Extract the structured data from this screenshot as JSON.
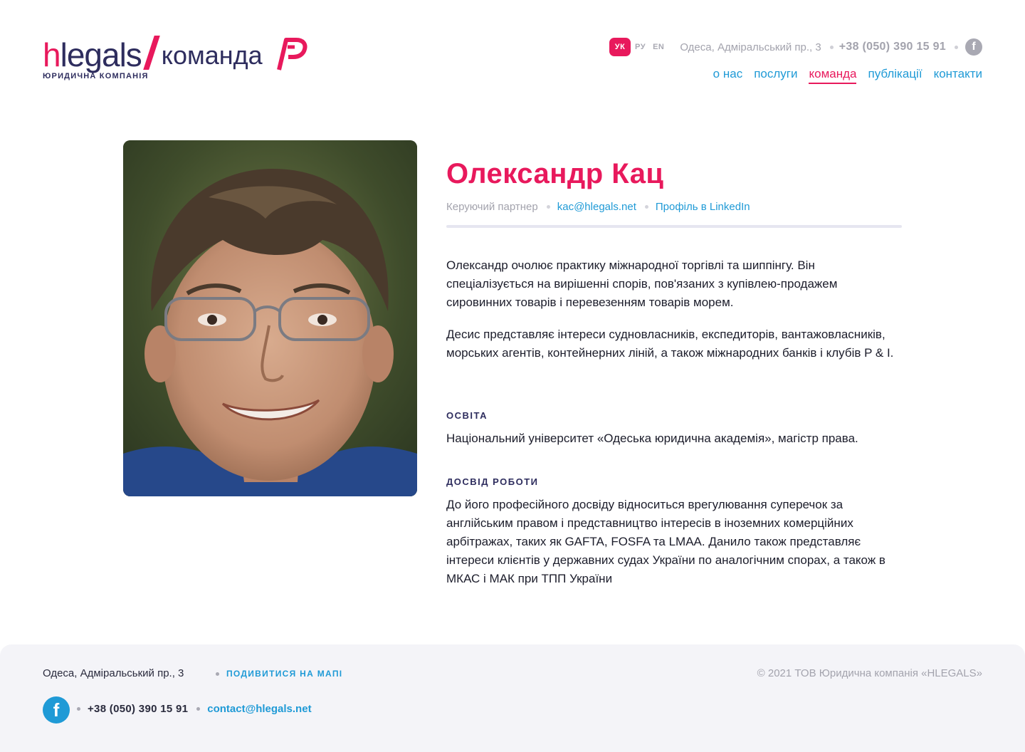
{
  "logo": {
    "h": "h",
    "legals": "legals",
    "team": "команда",
    "subtitle": "ЮРИДИЧНА КОМПАНІЯ"
  },
  "topbar": {
    "languages": [
      "УК",
      "РУ",
      "EN"
    ],
    "address": "Одеса, Адміральський пр., 3",
    "phone": "+38 (050) 390 15 91",
    "facebook_icon": "facebook-icon"
  },
  "nav": {
    "items": [
      "о нас",
      "послуги",
      "команда",
      "публікації",
      "контакти"
    ],
    "active": "команда"
  },
  "profile": {
    "name": "Олександр Кац",
    "role": "Керуючий партнер",
    "email": "kac@hlegals.net",
    "linkedin": "Профіль в LinkedIn",
    "bio_1": "Олександр очолює практику міжнародної торгівлі та шиппінгу. Він спеціалізується на вирішенні спорів, пов'язаних з купівлею-продажем сировинних товарів і перевезенням товарів морем.",
    "bio_2": "Десис представляє інтереси судновласників, експедиторів, вантажовласників, морських агентів, контейнерних ліній, а також міжнародних банків і клубів P & I.",
    "education_title": "ОСВІТА",
    "education": "Національний університет «Одеська юридична академія», магістр права.",
    "experience_title": "ДОСВІД РОБОТИ",
    "experience": "До його професійного досвіду відноситься врегулювання суперечок за англійським правом і представництво інтересів в іноземних комерційних арбітражах, таких як GAFTA, FOSFA та LMAA. Данило також представляє інтереси клієнтів у державних судах України по аналогічним спорах, а також в МКАС і МАК при ТПП України"
  },
  "footer": {
    "address": "Одеса, Адміральський пр., 3",
    "map_link": "ПОДИВИТИСЯ НА МАПІ",
    "copyright": "© 2021 ТОВ Юридична компанія «HLEGALS»",
    "phone": "+38 (050) 390 15 91",
    "email": "contact@hlegals.net"
  },
  "colors": {
    "accent": "#e8195c",
    "link": "#1f9ad6",
    "brand_dark": "#2e2d5e",
    "muted": "#a3a3ad"
  }
}
